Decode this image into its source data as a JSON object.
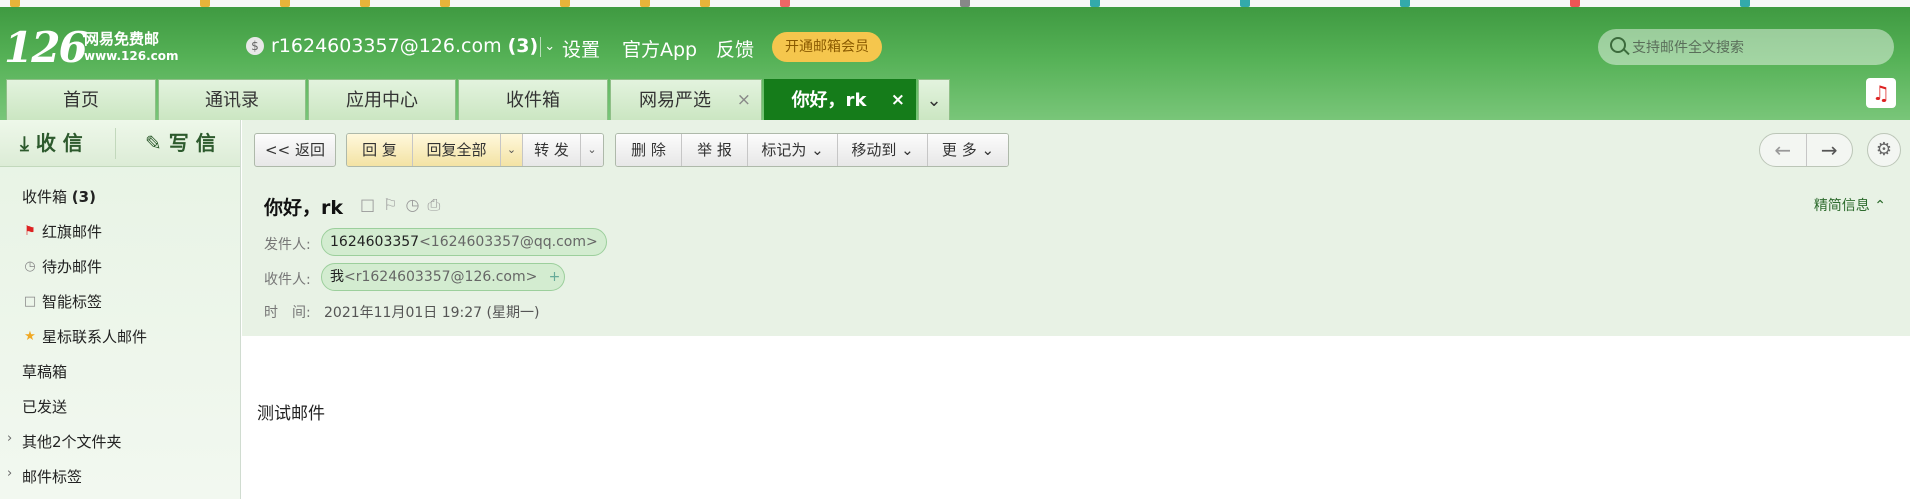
{
  "header": {
    "logo_number": "126",
    "logo_name": "网易免费邮",
    "logo_url": "www.126.com",
    "account_email": "r1624603357@126.com",
    "account_count": "(3)",
    "nav": [
      "设置",
      "官方App",
      "反馈"
    ],
    "vip_label": "开通邮箱会员",
    "search_placeholder": "支持邮件全文搜索"
  },
  "tabs": [
    {
      "label": "首页",
      "active": false
    },
    {
      "label": "通讯录",
      "active": false
    },
    {
      "label": "应用中心",
      "active": false
    },
    {
      "label": "收件箱",
      "active": false
    },
    {
      "label": "网易严选",
      "active": false,
      "closable": true
    },
    {
      "label": "你好，rk",
      "active": true,
      "closable": true
    }
  ],
  "sidebar": {
    "receive_label": "收 信",
    "compose_label": "写 信",
    "folders": [
      {
        "label": "收件箱",
        "count": "(3)"
      },
      {
        "label": "红旗邮件",
        "icon": "flag-icon"
      },
      {
        "label": "待办邮件",
        "icon": "clock-icon"
      },
      {
        "label": "智能标签",
        "icon": "bookmark-icon"
      },
      {
        "label": "星标联系人邮件",
        "icon": "star-icon"
      },
      {
        "label": "草稿箱"
      },
      {
        "label": "已发送"
      },
      {
        "label": "其他2个文件夹"
      },
      {
        "label": "邮件标签"
      }
    ]
  },
  "toolbar": {
    "back": "<< 返回",
    "reply": "回 复",
    "reply_all": "回复全部",
    "forward": "转 发",
    "delete": "删 除",
    "report": "举 报",
    "mark_as": "标记为",
    "move_to": "移动到",
    "more": "更 多"
  },
  "message": {
    "subject": "你好，rk",
    "from_label": "发件人:",
    "from_name": "1624603357",
    "from_addr": "<1624603357@qq.com>",
    "to_label": "收件人:",
    "to_name": "我",
    "to_addr": "<r1624603357@126.com>",
    "time_label": "时　间:",
    "time_value": "2021年11月01日 19:27 (星期一)",
    "brief_toggle": "精简信息",
    "body": "测试邮件"
  },
  "colors": {
    "brand_green": "#157c1a",
    "header_green": "#55b156",
    "vip_yellow": "#f5c64d"
  }
}
